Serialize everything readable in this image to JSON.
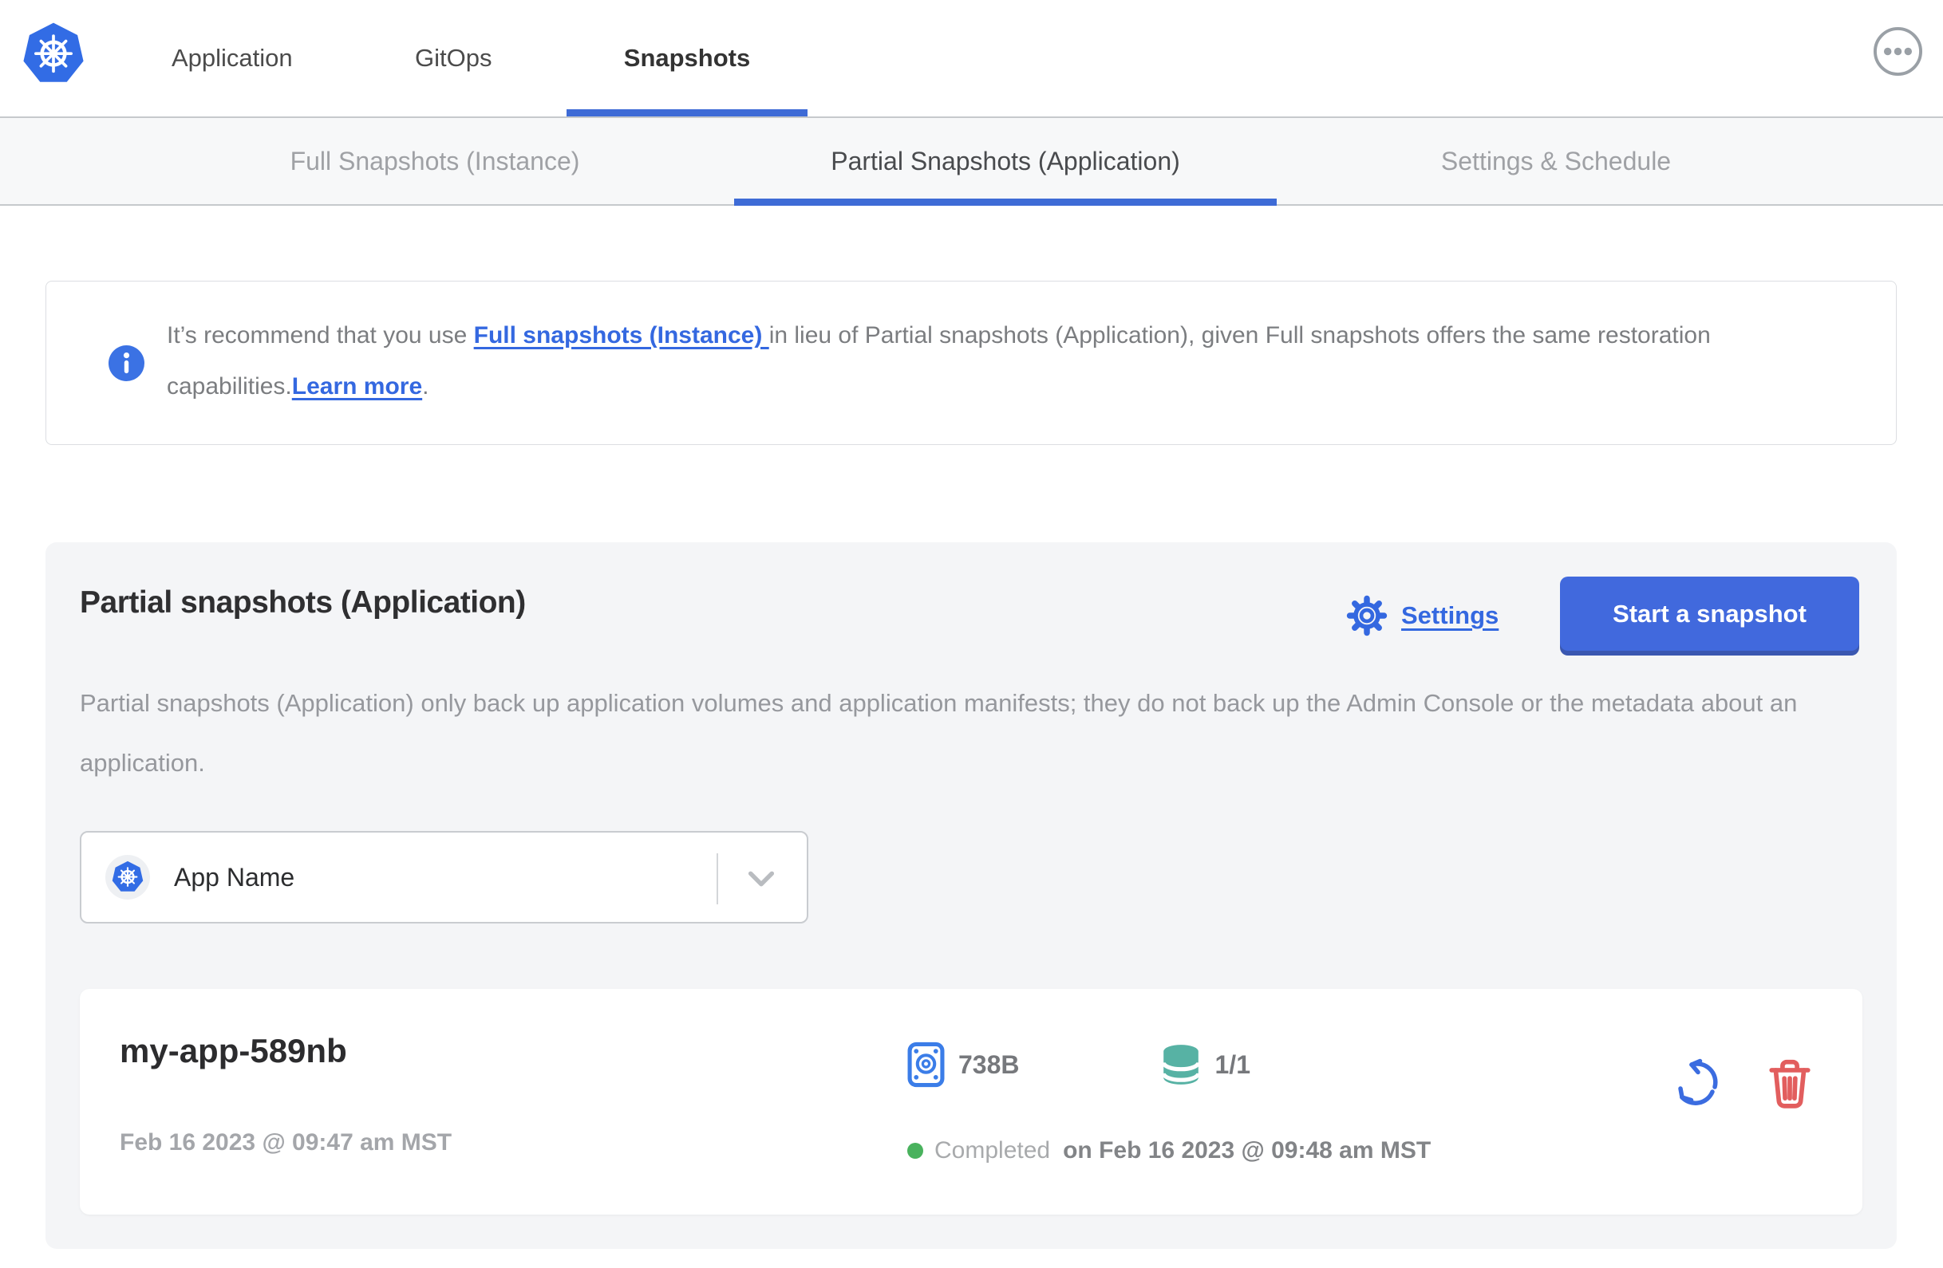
{
  "header": {
    "nav": [
      {
        "label": "Application",
        "active": false
      },
      {
        "label": "GitOps",
        "active": false
      },
      {
        "label": "Snapshots",
        "active": true
      }
    ]
  },
  "subnav": {
    "tabs": [
      {
        "label": "Full Snapshots (Instance)",
        "active": false
      },
      {
        "label": "Partial Snapshots (Application)",
        "active": true
      },
      {
        "label": "Settings & Schedule",
        "active": false
      }
    ]
  },
  "banner": {
    "text_before": "It’s recommend that you use ",
    "link_full_snapshots": "Full snapshots (Instance) ",
    "text_middle": "in lieu of Partial snapshots (Application), given Full snapshots offers the same restoration capabilities.",
    "link_learn_more": "Learn more",
    "text_after": "."
  },
  "main": {
    "title": "Partial snapshots (Application)",
    "settings_label": "Settings",
    "start_button_label": "Start a snapshot",
    "description": "Partial snapshots (Application) only back up application volumes and application manifests; they do not back up the Admin Console or the metadata about an application.",
    "app_selector": {
      "value": "App Name"
    }
  },
  "snapshot_row": {
    "name": "my-app-589nb",
    "created": "Feb 16 2023 @ 09:47 am MST",
    "size": "738B",
    "volumes": "1/1",
    "status": "Completed",
    "status_detail": "on Feb 16 2023 @ 09:48 am MST"
  },
  "icons": {
    "logo": "kubernetes-logo",
    "menu": "ellipsis-menu-icon",
    "info": "info-icon",
    "gear": "gear-icon",
    "chevron": "chevron-down-icon",
    "disk": "disk-icon",
    "database": "database-icon",
    "restore": "restore-icon",
    "trash": "trash-icon"
  },
  "colors": {
    "accent_blue": "#3e6bd6",
    "link_blue": "#3468e0",
    "button_blue": "#4169dd",
    "logo_blue": "#326ce5",
    "teal": "#57b2a4",
    "red": "#e25e5e",
    "green": "#49b25d",
    "card_bg": "#f4f5f7",
    "subnav_bg": "#f7f8f9"
  }
}
